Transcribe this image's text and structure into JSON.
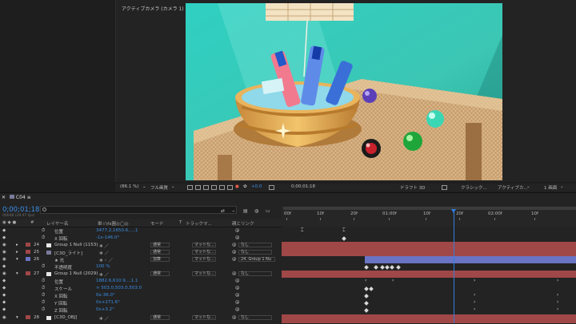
{
  "viewer": {
    "camera_label": "アクティブカメラ (カメラ 1)",
    "toolbar": {
      "zoom": "(86.1 %)",
      "resolution": "フル画質",
      "plus_value": "+0.0",
      "timecode": "0;00;01;18",
      "draft": "ドラフト 3D",
      "renderer": "クラシック...",
      "camera": "アクティブカ...",
      "views": "1 画面"
    }
  },
  "timeline": {
    "comp_tab": "C04",
    "timecode": "0;00;01;18",
    "frame_sub": "00048 (29.97 fps)",
    "search_placeholder": "",
    "headers": {
      "layer_name": "レイヤー名",
      "switches": "単☆\\fx圓◎◯◎",
      "mode": "モード",
      "t": "T",
      "trackmatte": "トラックマ...",
      "parent": "親とリンク"
    },
    "ruler_ticks": [
      "00f",
      "10f",
      "20f",
      "01:00f",
      "10f",
      "20f",
      "02:00f",
      "10f"
    ],
    "rows": [
      {
        "num": "",
        "name": "位置",
        "value": "3477.2,1650.6,...,1",
        "prop": true
      },
      {
        "num": "",
        "name": "X 回転",
        "value": "-1x-146.0°",
        "prop": true
      },
      {
        "num": "24",
        "name": "Group 1 Null (1153)",
        "mode": "通常",
        "matte": "マットな...",
        "parent": "なし",
        "label": "#a04747"
      },
      {
        "num": "25",
        "name": "[C3D_ライト]",
        "mode": "通常",
        "matte": "マットな...",
        "parent": "なし",
        "label": "#a04747"
      },
      {
        "num": "26",
        "name": "★ 光",
        "mode": "加算",
        "matte": "マットな...",
        "parent": "24. Group 1 Nu",
        "label": "#6a74c4"
      },
      {
        "num": "",
        "name": "不透明度",
        "value": "100 %",
        "prop": true
      },
      {
        "num": "27",
        "name": "Group 1 Null (2029)",
        "mode": "通常",
        "matte": "マットな...",
        "parent": "なし",
        "label": "#a04747"
      },
      {
        "num": "",
        "name": "位置",
        "value": "1882.6,610.9,...1.1",
        "prop": true
      },
      {
        "num": "",
        "name": "スケール",
        "value": "∞ 503.0,503.0,503.0",
        "prop": true
      },
      {
        "num": "",
        "name": "X 回転",
        "value": "0x-36.0°",
        "prop": true
      },
      {
        "num": "",
        "name": "Y 回転",
        "value": "0x+271.6°",
        "prop": true
      },
      {
        "num": "",
        "name": "Z 回転",
        "value": "0x+3.2°",
        "prop": true
      },
      {
        "num": "28",
        "name": "[C3D_OBJ]",
        "mode": "通常",
        "matte": "マットな...",
        "parent": "なし",
        "label": "#a04747"
      }
    ]
  },
  "colors": {
    "accent": "#3a8ee6",
    "bar_red": "#a04747",
    "bar_blue": "#6a74c4"
  }
}
